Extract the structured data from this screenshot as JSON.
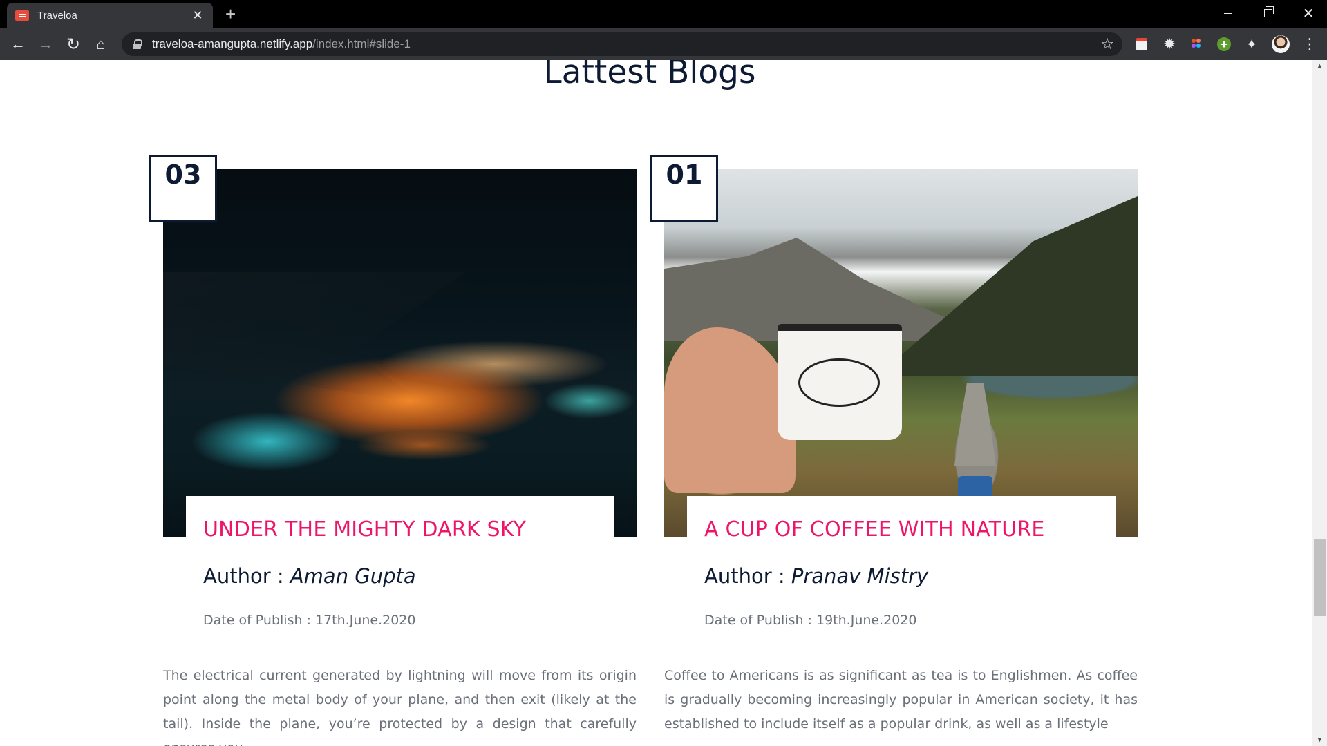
{
  "browser": {
    "tab_title": "Traveloa",
    "tab_close": "✕",
    "new_tab": "+",
    "url_host": "traveloa-amangupta.netlify.app",
    "url_path": "/index.html#slide-1",
    "icons": [
      "back-arrow-icon",
      "forward-arrow-icon",
      "reload-icon",
      "home-icon",
      "lock-icon",
      "star-icon",
      "extensions-puzzle-icon",
      "more-vert-icon"
    ]
  },
  "section": {
    "title": "Lattest Blogs"
  },
  "cards": [
    {
      "number": "03",
      "title": "UNDER THE MIGHTY DARK SKY",
      "author_label": "Author : ",
      "author_name": "Aman Gupta",
      "date": "Date of Publish : 17th.June.2020",
      "body": "The electrical current generated by lightning will move from its origin point along the metal body of your plane, and then exit (likely at the tail). Inside the plane, you’re protected by a design that carefully ensures you"
    },
    {
      "number": "01",
      "title": "A CUP OF COFFEE WITH NATURE",
      "author_label": "Author : ",
      "author_name": "Pranav Mistry",
      "date": "Date of Publish : 19th.June.2020",
      "body": "Coffee to Americans is as significant as tea is to Englishmen. As coffee is gradually becoming increasingly popular in American society, it has established to include itself as a popular drink, as well as a lifestyle"
    }
  ],
  "colors": {
    "accent": "#ee1467",
    "heading": "#0d1a33",
    "body_text": "#6a6f78",
    "chrome_dark": "#35363a"
  }
}
